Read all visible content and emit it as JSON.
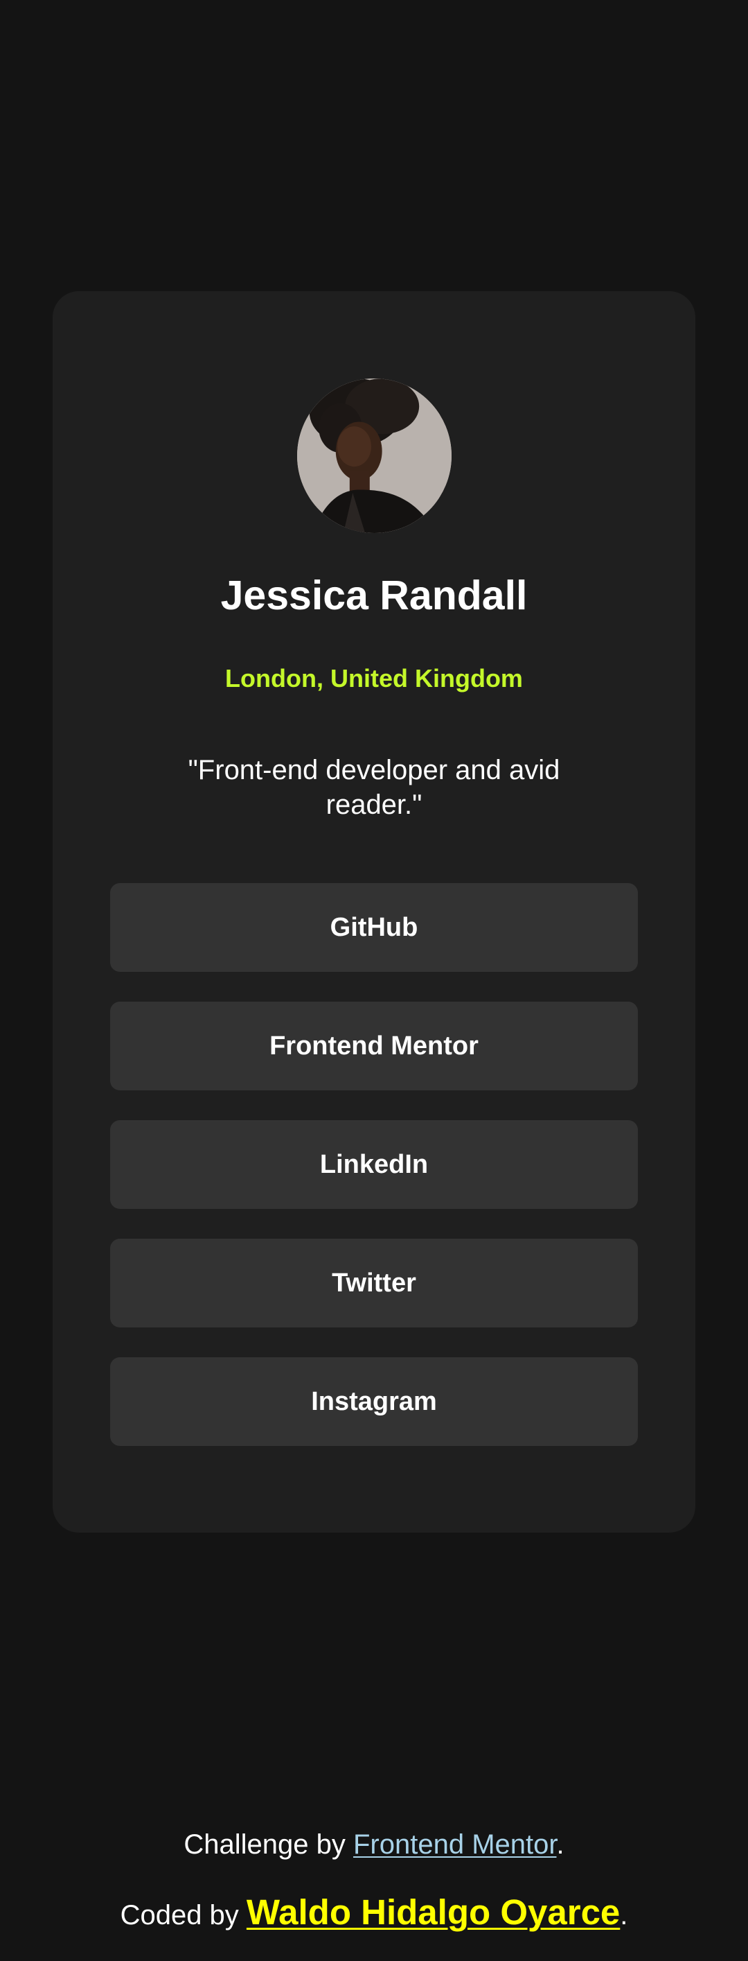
{
  "profile": {
    "name": "Jessica Randall",
    "location": "London, United Kingdom",
    "bio": "\"Front-end developer and avid reader.\""
  },
  "links": [
    {
      "label": "GitHub"
    },
    {
      "label": "Frontend Mentor"
    },
    {
      "label": "LinkedIn"
    },
    {
      "label": "Twitter"
    },
    {
      "label": "Instagram"
    }
  ],
  "footer": {
    "challenge_prefix": "Challenge by ",
    "challenge_link": "Frontend Mentor",
    "challenge_suffix": ".",
    "coded_prefix": "Coded by ",
    "coded_link": "Waldo Hidalgo Oyarce",
    "coded_suffix": "."
  },
  "colors": {
    "background": "#141414",
    "card": "#1f1f1f",
    "button": "#333333",
    "accent_green": "#c4f82a",
    "footer_link": "#a8d2e8",
    "author_link": "#ffff00"
  }
}
